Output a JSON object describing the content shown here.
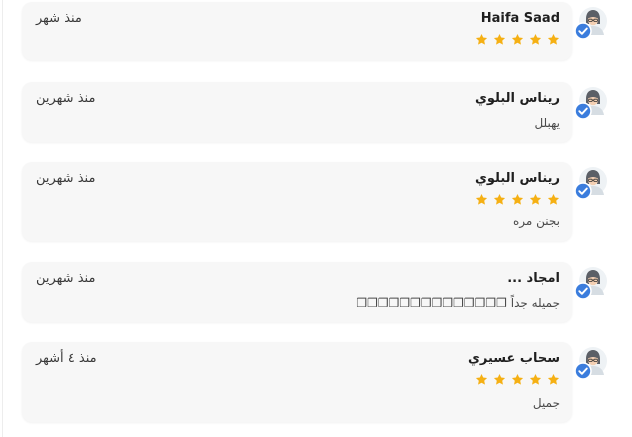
{
  "reviews": [
    {
      "name": "Haifa Saad",
      "time": "منذ شهر",
      "stars": 5,
      "comment": ""
    },
    {
      "name": "ريناس البلوي",
      "time": "منذ شهرين",
      "stars": 0,
      "comment": "يهبلل"
    },
    {
      "name": "ريناس البلوي",
      "time": "منذ شهرين",
      "stars": 5,
      "comment": "بجنن مره"
    },
    {
      "name": "امجاد ...",
      "time": "منذ شهرين",
      "stars": 0,
      "comment": "جميله جداً ❒❒❒❒❒❒❒❒❒❒❒❒❒❒"
    },
    {
      "name": "سحاب عسيري",
      "time": "منذ ٤ أشهر",
      "stars": 5,
      "comment": "جميل"
    }
  ],
  "colors": {
    "star": "#f5b014",
    "card": "#f7f7f7",
    "verified": "#3b7ddd"
  },
  "icons": {
    "avatar": "verified-user-avatar-icon",
    "star": "star-icon"
  }
}
